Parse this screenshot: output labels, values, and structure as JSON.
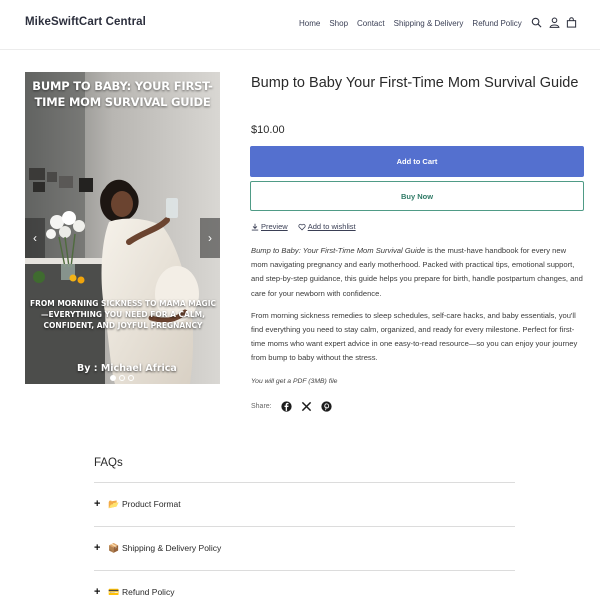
{
  "header": {
    "brand": "MikeSwiftCart Central",
    "nav": [
      "Home",
      "Shop",
      "Contact",
      "Shipping & Delivery",
      "Refund Policy"
    ]
  },
  "gallery": {
    "cover_title_line1": "BUMP TO BABY: YOUR FIRST-",
    "cover_title_line2": "TIME MOM SURVIVAL GUIDE",
    "cover_sub": "FROM MORNING SICKNESS TO MAMA MAGIC—EVERYTHING YOU NEED FOR A CALM, CONFIDENT, AND JOYFUL PREGNANCY",
    "cover_author": "By : Michael Africa",
    "prev_arrow": "‹",
    "next_arrow": "›",
    "active_slide": 1,
    "slide_count": 3
  },
  "product": {
    "title": "Bump to Baby Your First-Time Mom Survival Guide",
    "price": "$10.00",
    "add_to_cart": "Add to Cart",
    "buy_now": "Buy Now",
    "preview": "Preview",
    "wishlist": "Add to wishlist",
    "desc_p1_em": "Bump to Baby: Your First-Time Mom Survival Guide",
    "desc_p1_rest": " is the must-have handbook for every new mom navigating pregnancy and early motherhood. Packed with practical tips, emotional support, and step-by-step guidance, this guide helps you prepare for birth, handle postpartum changes, and care for your newborn with confidence.",
    "desc_p2": "From morning sickness remedies to sleep schedules, self-care hacks, and baby essentials, you'll find everything you need to stay calm, organized, and ready for every milestone. Perfect for first-time moms who want expert advice in one easy-to-read resource—so you can enjoy your journey from bump to baby without the stress.",
    "file_note": "You will get a PDF (3MB) file",
    "share_label": "Share:"
  },
  "faq": {
    "title": "FAQs",
    "items": [
      {
        "emoji": "📂",
        "label": "Product Format"
      },
      {
        "emoji": "📦",
        "label": "Shipping & Delivery Policy"
      },
      {
        "emoji": "💳",
        "label": "Refund Policy"
      }
    ]
  },
  "colors": {
    "accent": "#5470cf",
    "buy_border": "#4f9b86"
  },
  "icons": [
    "search-icon",
    "user-icon",
    "bag-icon",
    "download-icon",
    "heart-icon",
    "facebook-icon",
    "x-icon",
    "pinterest-icon",
    "plus-icon"
  ]
}
